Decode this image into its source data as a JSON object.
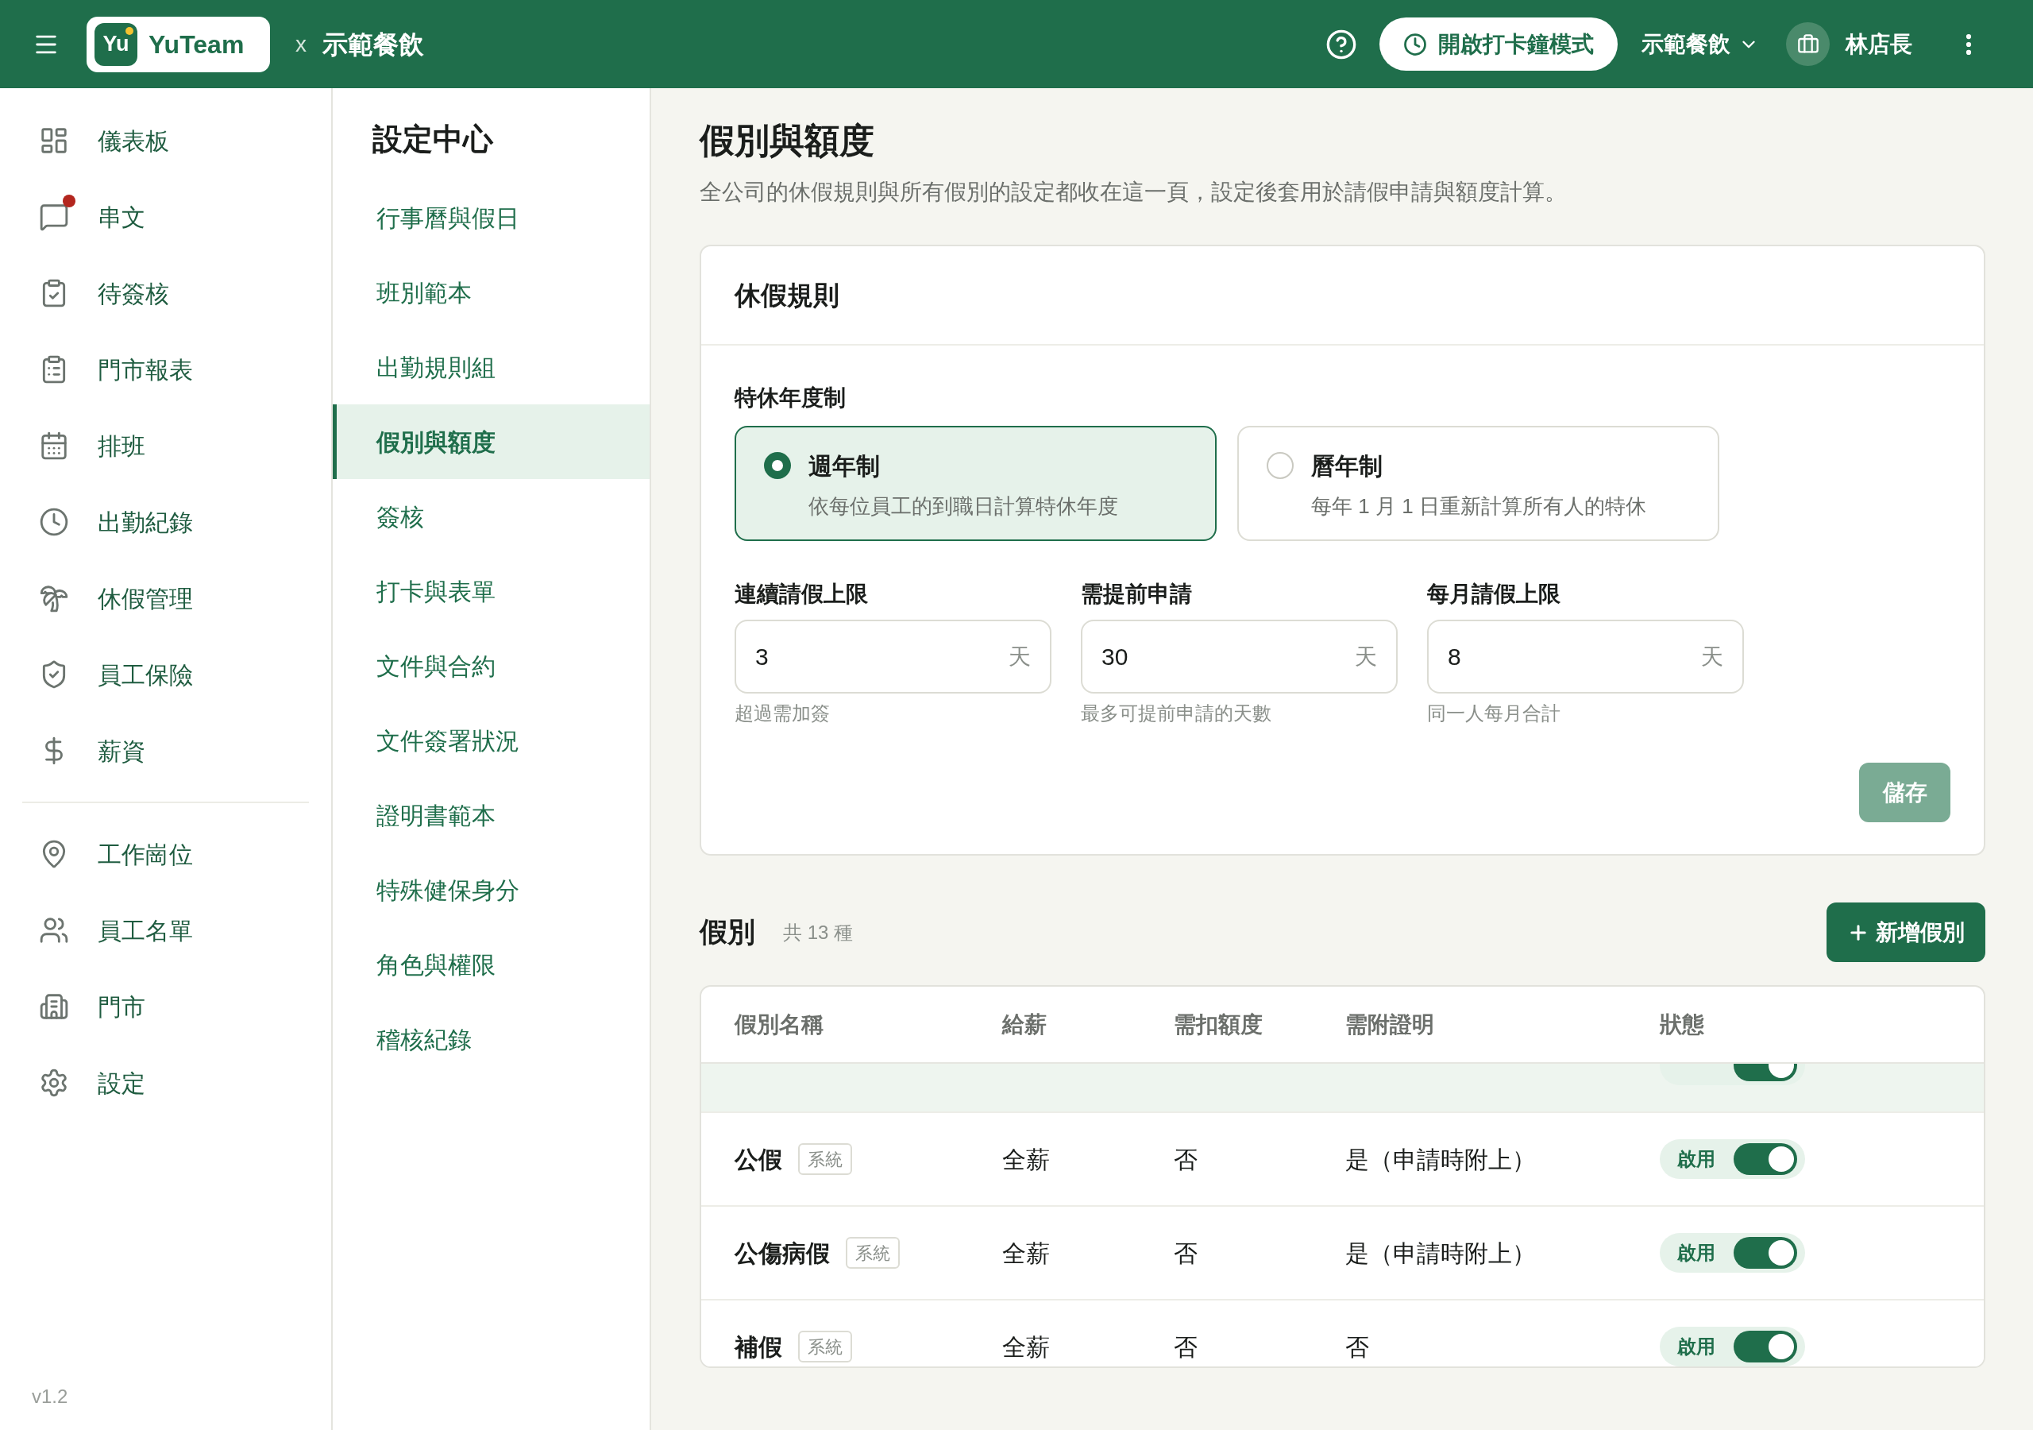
{
  "top_bar": {
    "logo_initials": "Yu",
    "brand_name": "YuTeam",
    "separator": "x",
    "company": "示範餐飲",
    "clock_mode_button": "開啟打卡鐘模式",
    "store_selector": "示範餐飲",
    "user_name": "林店長"
  },
  "sidebar": {
    "groups": [
      [
        {
          "label": "儀表板",
          "unread": false,
          "selected": false
        },
        {
          "label": "串文",
          "unread": true,
          "selected": false
        },
        {
          "label": "待簽核",
          "unread": false,
          "selected": false
        },
        {
          "label": "門市報表",
          "unread": false,
          "selected": false
        },
        {
          "label": "排班",
          "unread": false,
          "selected": false
        },
        {
          "label": "出勤紀錄",
          "unread": false,
          "selected": false
        },
        {
          "label": "休假管理",
          "unread": false,
          "selected": false
        },
        {
          "label": "員工保險",
          "unread": false,
          "selected": false
        },
        {
          "label": "薪資",
          "unread": false,
          "selected": false
        }
      ],
      [
        {
          "label": "工作崗位",
          "unread": false,
          "selected": false
        },
        {
          "label": "員工名單",
          "unread": false,
          "selected": false
        },
        {
          "label": "門市",
          "unread": false,
          "selected": false
        },
        {
          "label": "設定",
          "unread": false,
          "selected": false
        }
      ]
    ],
    "version": "v1.2"
  },
  "settings_nav": {
    "title": "設定中心",
    "items": [
      {
        "label": "行事曆與假日",
        "selected": false
      },
      {
        "label": "班別範本",
        "selected": false
      },
      {
        "label": "出勤規則組",
        "selected": false
      },
      {
        "label": "假別與額度",
        "selected": true
      },
      {
        "label": "簽核",
        "selected": false
      },
      {
        "label": "打卡與表單",
        "selected": false
      },
      {
        "label": "文件與合約",
        "selected": false
      },
      {
        "label": "文件簽署狀況",
        "selected": false
      },
      {
        "label": "證明書範本",
        "selected": false
      },
      {
        "label": "特殊健保身分",
        "selected": false
      },
      {
        "label": "角色與權限",
        "selected": false
      },
      {
        "label": "稽核紀錄",
        "selected": false
      }
    ]
  },
  "page": {
    "title": "假別與額度",
    "description": "全公司的休假規則與所有假別的設定都收在這一頁，設定後套用於請假申請與額度計算。"
  },
  "leave_rules": {
    "title": "休假規則",
    "annual_leave_system": {
      "label": "特休年度制",
      "options": [
        {
          "title": "週年制",
          "description": "依每位員工的到職日計算特休年度",
          "selected": true
        },
        {
          "title": "曆年制",
          "description": "每年 1 月 1 日重新計算所有人的特休",
          "selected": false
        }
      ]
    },
    "fields": [
      {
        "label": "連續請假上限",
        "value": "3",
        "unit": "天",
        "helper_text": "超過需加簽"
      },
      {
        "label": "需提前申請",
        "value": "30",
        "unit": "天",
        "helper_text": "最多可提前申請的天數"
      },
      {
        "label": "每月請假上限",
        "value": "8",
        "unit": "天",
        "helper_text": "同一人每月合計"
      }
    ],
    "save_button": {
      "label": "儲存",
      "disabled": true
    }
  },
  "leave_types": {
    "title": "假別",
    "count": "共 13 種",
    "add_button": "新增假別",
    "table": {
      "columns": [
        "假別名稱",
        "給薪",
        "需扣額度",
        "需附證明",
        "狀態"
      ],
      "rows": [
        {
          "status": {
            "on": true
          },
          "hovered": true
        },
        {
          "name": "公假",
          "tag": "系統",
          "pay": "全薪",
          "deducts_quota": "否",
          "proof_required": "是（申請時附上）",
          "status": {
            "label": "啟用",
            "on": true
          },
          "hovered": false
        },
        {
          "name": "公傷病假",
          "tag": "系統",
          "pay": "全薪",
          "deducts_quota": "否",
          "proof_required": "是（申請時附上）",
          "status": {
            "label": "啟用",
            "on": true
          },
          "hovered": false
        },
        {
          "name": "補假",
          "tag": "系統",
          "pay": "全薪",
          "deducts_quota": "否",
          "proof_required": "否",
          "status": {
            "label": "啟用",
            "on": true
          },
          "hovered": false
        }
      ]
    }
  }
}
